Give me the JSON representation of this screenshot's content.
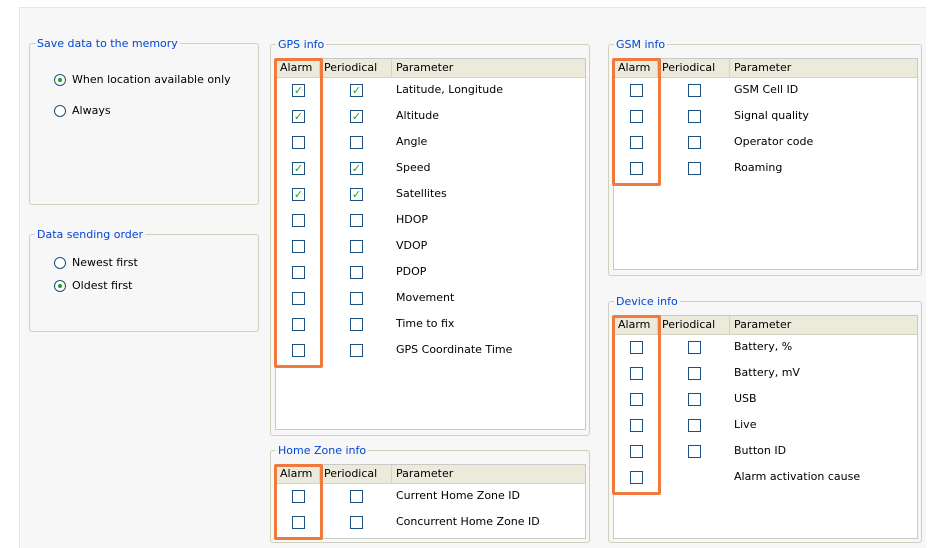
{
  "save_data": {
    "title": "Save data to the memory",
    "options": [
      {
        "label": "When location available only",
        "selected": true
      },
      {
        "label": "Always",
        "selected": false
      }
    ]
  },
  "sending_order": {
    "title": "Data sending order",
    "options": [
      {
        "label": "Newest first",
        "selected": false
      },
      {
        "label": "Oldest first",
        "selected": true
      }
    ]
  },
  "columns": {
    "alarm": "Alarm",
    "periodical": "Periodical",
    "parameter": "Parameter"
  },
  "gps_info": {
    "title": "GPS info",
    "rows": [
      {
        "parameter": "Latitude, Longitude",
        "alarm": true,
        "periodical": true
      },
      {
        "parameter": "Altitude",
        "alarm": true,
        "periodical": true
      },
      {
        "parameter": "Angle",
        "alarm": false,
        "periodical": false
      },
      {
        "parameter": "Speed",
        "alarm": true,
        "periodical": true
      },
      {
        "parameter": "Satellites",
        "alarm": true,
        "periodical": true
      },
      {
        "parameter": "HDOP",
        "alarm": false,
        "periodical": false
      },
      {
        "parameter": "VDOP",
        "alarm": false,
        "periodical": false
      },
      {
        "parameter": "PDOP",
        "alarm": false,
        "periodical": false
      },
      {
        "parameter": "Movement",
        "alarm": false,
        "periodical": false
      },
      {
        "parameter": "Time to fix",
        "alarm": false,
        "periodical": false
      },
      {
        "parameter": "GPS Coordinate Time",
        "alarm": false,
        "periodical": false
      }
    ]
  },
  "home_zone_info": {
    "title": "Home Zone info",
    "rows": [
      {
        "parameter": "Current Home Zone ID",
        "alarm": false,
        "periodical": false
      },
      {
        "parameter": "Concurrent Home Zone ID",
        "alarm": false,
        "periodical": false
      }
    ]
  },
  "gsm_info": {
    "title": "GSM info",
    "rows": [
      {
        "parameter": "GSM Cell ID",
        "alarm": false,
        "periodical": false
      },
      {
        "parameter": "Signal quality",
        "alarm": false,
        "periodical": false
      },
      {
        "parameter": "Operator code",
        "alarm": false,
        "periodical": false
      },
      {
        "parameter": "Roaming",
        "alarm": false,
        "periodical": false
      }
    ]
  },
  "device_info": {
    "title": "Device info",
    "rows": [
      {
        "parameter": "Battery, %",
        "alarm": false,
        "periodical": false
      },
      {
        "parameter": "Battery, mV",
        "alarm": false,
        "periodical": false
      },
      {
        "parameter": "USB",
        "alarm": false,
        "periodical": false
      },
      {
        "parameter": "Live",
        "alarm": false,
        "periodical": false
      },
      {
        "parameter": "Button ID",
        "alarm": false,
        "periodical": false
      },
      {
        "parameter": "Alarm activation cause",
        "alarm": false,
        "periodical": null
      }
    ]
  },
  "colors": {
    "legend": "#0046d5",
    "highlight": "#f07a3c",
    "check": "#21a121"
  }
}
